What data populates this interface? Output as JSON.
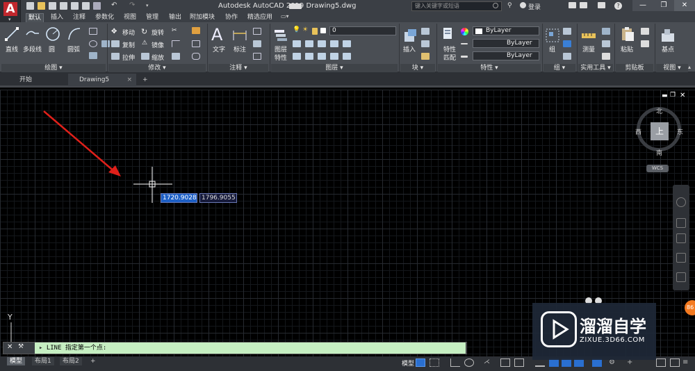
{
  "window": {
    "title": "Autodesk AutoCAD 2019    Drawing5.dwg",
    "search_placeholder": "键入关键字或短语",
    "login": "登录",
    "controls": [
      "—",
      "❐",
      "✕"
    ]
  },
  "ribbon_tabs": [
    "默认",
    "插入",
    "注释",
    "参数化",
    "视图",
    "管理",
    "输出",
    "附加模块",
    "协作",
    "精选应用"
  ],
  "panels": {
    "draw": {
      "title": "绘图 ▾",
      "line": "直线",
      "polyline": "多段线",
      "circle": "圆",
      "arc": "圆弧"
    },
    "modify": {
      "title": "修改 ▾",
      "move": "移动",
      "rotate": "旋转",
      "copy": "复制",
      "mirror": "镜像",
      "stretch": "拉伸",
      "scale": "缩放"
    },
    "annotation": {
      "title": "注释 ▾",
      "text": "文字",
      "dimension": "标注"
    },
    "layers": {
      "title": "图层 ▾",
      "layer_props": "图层\n特性",
      "layer_props_1": "图层",
      "layer_props_2": "特性",
      "current_layer": "0"
    },
    "block": {
      "title": "块 ▾",
      "insert": "插入"
    },
    "properties": {
      "title": "特性 ▾",
      "match_1": "特性",
      "match_2": "匹配",
      "color": "ByLayer",
      "linetype": "ByLayer",
      "lineweight": "ByLayer"
    },
    "groups": {
      "title": "组 ▾",
      "group": "组"
    },
    "utilities": {
      "title": "实用工具 ▾",
      "measure": "测量"
    },
    "clipboard": {
      "title": "剪贴板",
      "paste": "粘贴"
    },
    "view": {
      "title": "视图 ▾",
      "base": "基点"
    }
  },
  "file_tabs": [
    {
      "label": "开始"
    },
    {
      "label": "Drawing5",
      "close": "×"
    }
  ],
  "new_tab": "+",
  "cursor_input": {
    "x": "1720.9028",
    "y": "1796.9055"
  },
  "viewcube": {
    "north": "北",
    "south": "南",
    "east": "东",
    "west": "西",
    "top": "上",
    "wcs": "WCS"
  },
  "ucs": {
    "y": "Y"
  },
  "command": {
    "prompt": "LINE 指定第一个点:",
    "close": "✕",
    "settings": "🔧"
  },
  "layout_tabs": [
    "模型",
    "布局1",
    "布局2",
    "+"
  ],
  "status": {
    "model": "模型"
  },
  "watermark": {
    "brand": "溜溜自学",
    "url": "ZIXUE.3D66.COM"
  },
  "badge": "86",
  "colors": {
    "accent": "#1d5fc5",
    "cmdline": "#c6efc2",
    "arrow": "#e0201a",
    "app_red": "#c1272d"
  }
}
